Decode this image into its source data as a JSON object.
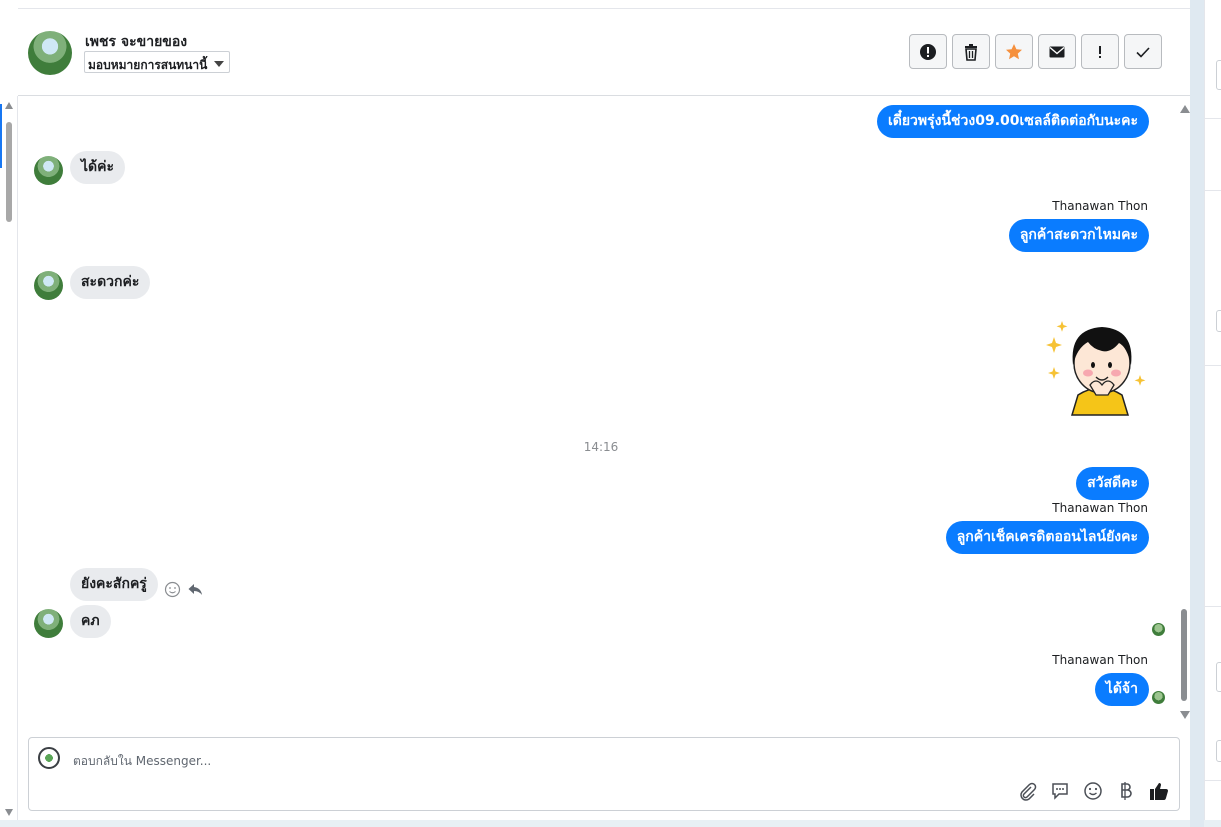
{
  "header": {
    "name": "เพชร จะขายของ",
    "assign_label": "มอบหมายการสนทนานี้",
    "tools": [
      "alert-icon",
      "trash-icon",
      "star-icon",
      "mail-icon",
      "exclamation-icon",
      "check-icon"
    ],
    "star_color": "#f5903d"
  },
  "messages": {
    "m1": "เดี๋ยวพรุ่งนี้ช่วง09.00เซลล์ติดต่อกับนะคะ",
    "m2": "ได้ค่ะ",
    "sender1": "Thanawan Thon",
    "m3": "ลูกค้าสะดวกไหมคะ",
    "m4": "สะดวกค่ะ",
    "time": "14:16",
    "m5": "สวัสดีคะ",
    "sender2": "Thanawan Thon",
    "m6": "ลูกค้าเช็คเครดิตออนไลน์ยังคะ",
    "m7": "ยังคะสักครู่",
    "m8": "คภ",
    "sender3": "Thanawan Thon",
    "m9": "ได้จ้า"
  },
  "composer": {
    "placeholder": "ตอบกลับใน Messenger...",
    "icons": [
      "attachment-icon",
      "saved-reply-icon",
      "emoji-icon",
      "baht-icon",
      "like-icon"
    ]
  },
  "colors": {
    "outgoing_bubble": "#0a7cff",
    "incoming_bubble": "#e9ebee"
  }
}
